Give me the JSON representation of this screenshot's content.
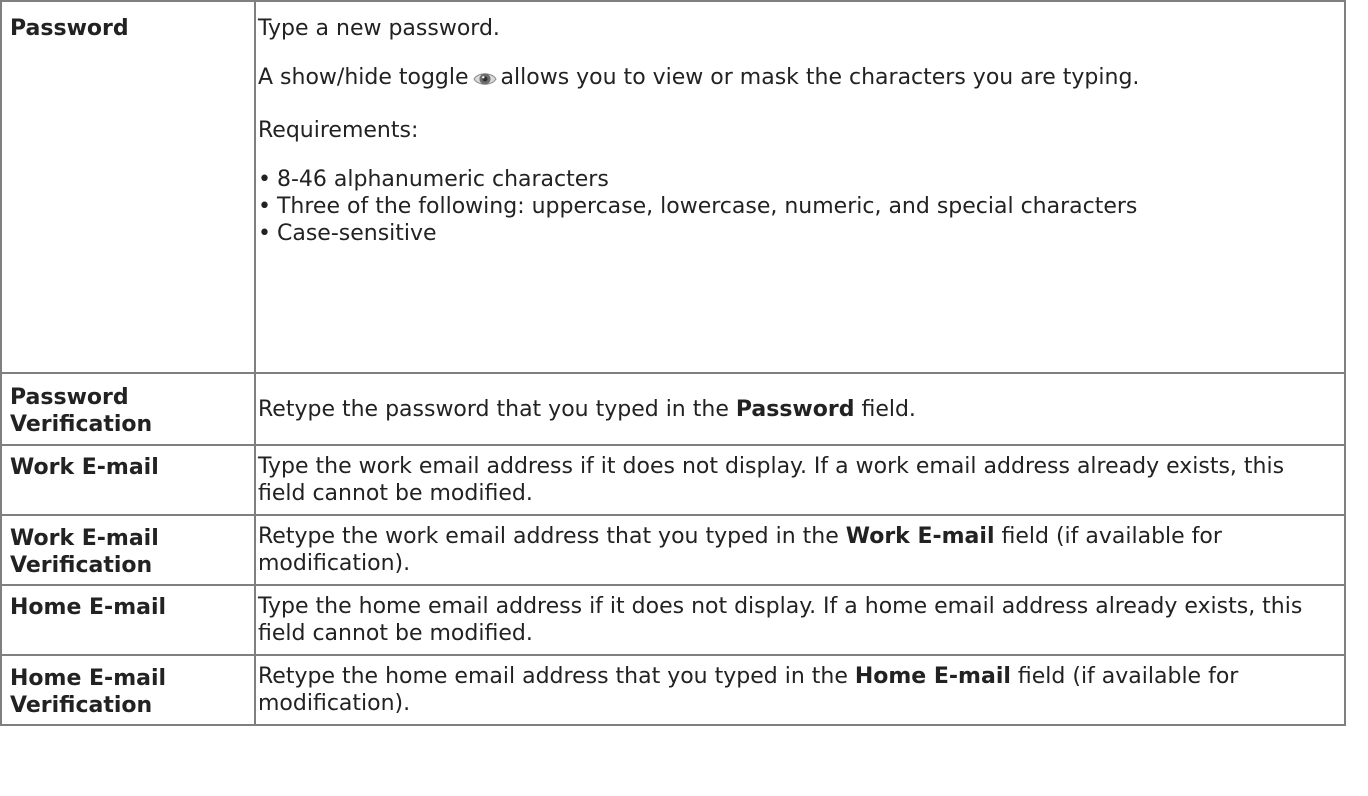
{
  "rows": [
    {
      "label": "Password",
      "intro": "Type a new password.",
      "toggle_before": "A show/hide toggle",
      "toggle_icon": "eye-icon",
      "toggle_after": "allows you to view or mask the characters you are typing.",
      "requirements_heading": "Requirements:",
      "requirements": [
        "8-46 alphanumeric characters",
        "Three of the following: uppercase, lowercase, numeric, and special characters",
        "Case-sensitive"
      ],
      "bullet": "•"
    },
    {
      "label": "Password Verification",
      "before": "Retype the password that you typed in the ",
      "bold": "Password",
      "after": " field."
    },
    {
      "label": "Work E-mail",
      "text": "Type the work email address if it does not display. If a work email address already exists, this field cannot be modified."
    },
    {
      "label": "Work E-mail Verification",
      "before": "Retype the work email address that you typed in the ",
      "bold": "Work E-mail",
      "after": " field (if available for modification)."
    },
    {
      "label": "Home E-mail",
      "text": "Type the home email address if it does not display. If a home email address already exists, this field cannot be modified."
    },
    {
      "label": "Home E-mail Verification",
      "before": "Retype the home email address that you typed in the ",
      "bold": "Home E-mail",
      "after": " field (if available for modification)."
    }
  ]
}
